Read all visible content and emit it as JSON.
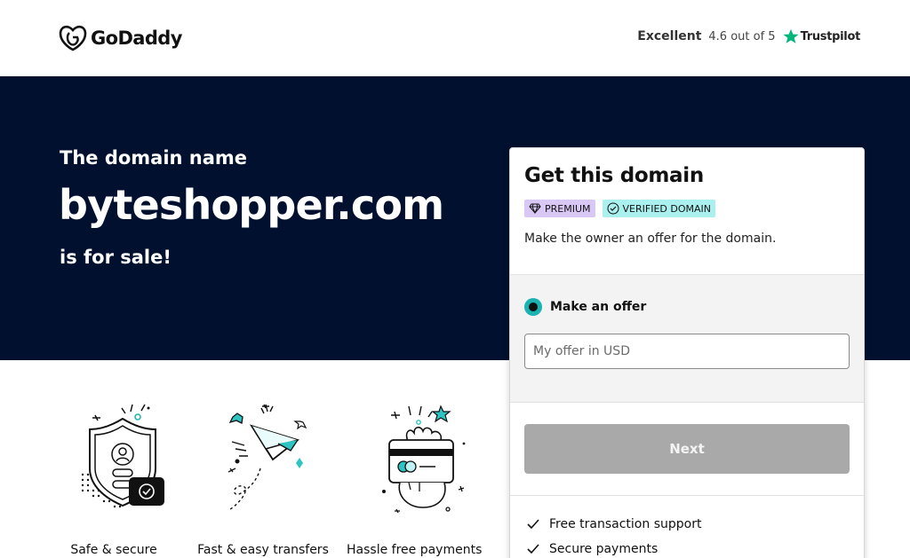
{
  "header": {
    "logo_text": "GoDaddy",
    "trustpilot": {
      "rating_word": "Excellent",
      "score_text": "4.6 out of 5",
      "brand": "Trustpilot",
      "star_color": "#00b67a"
    }
  },
  "hero": {
    "pre": "The domain name",
    "domain": "byteshopper.com",
    "post": "is for sale!"
  },
  "features": [
    {
      "label": "Safe & secure",
      "icon": "shield-icon"
    },
    {
      "label": "Fast & easy transfers",
      "icon": "paper-plane-icon"
    },
    {
      "label": "Hassle free payments",
      "icon": "hand-card-icon"
    }
  ],
  "card": {
    "title": "Get this domain",
    "badges": {
      "premium": "PREMIUM",
      "verified": "VERIFIED DOMAIN"
    },
    "description": "Make the owner an offer for the domain.",
    "offer_option_label": "Make an offer",
    "offer_placeholder": "My offer in USD",
    "offer_value": "",
    "next_label": "Next",
    "benefits": [
      "Free transaction support",
      "Secure payments"
    ]
  },
  "colors": {
    "hero_bg": "#00102e",
    "accent_teal": "#1bb2b2",
    "premium_badge": "#d9c8f5",
    "verified_badge": "#a9f0ee",
    "button_disabled": "#a9a9a9"
  }
}
